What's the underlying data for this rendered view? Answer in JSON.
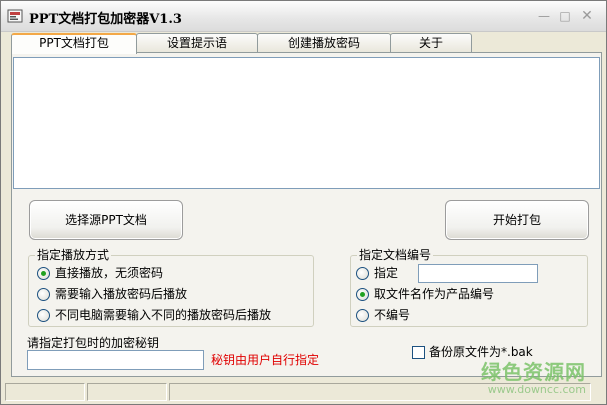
{
  "window": {
    "title": "PPT文档打包加密器V1.3",
    "controls": {
      "minimize": "—",
      "maximize": "□",
      "close": "✕"
    }
  },
  "tabs": [
    {
      "label": "PPT文档打包",
      "active": true
    },
    {
      "label": "设置提示语",
      "active": false
    },
    {
      "label": "创建播放密码",
      "active": false
    },
    {
      "label": "关于",
      "active": false
    }
  ],
  "buttons": {
    "select_source": "选择源PPT文档",
    "start_pack": "开始打包"
  },
  "play_mode": {
    "legend": "指定播放方式",
    "options": [
      {
        "label": "直接播放，无须密码",
        "checked": true
      },
      {
        "label": "需要输入播放密码后播放",
        "checked": false
      },
      {
        "label": "不同电脑需要输入不同的播放密码后播放",
        "checked": false
      }
    ]
  },
  "doc_number": {
    "legend": "指定文档编号",
    "options": [
      {
        "label": "指定",
        "checked": false
      },
      {
        "label": "取文件名作为产品编号",
        "checked": true
      },
      {
        "label": "不编号",
        "checked": false
      }
    ],
    "number_value": ""
  },
  "encryption_key": {
    "label": "请指定打包时的加密秘钥",
    "value": "",
    "hint": "秘钥由用户自行指定"
  },
  "backup": {
    "label": "备份原文件为*.bak",
    "checked": false
  },
  "watermark": {
    "main": "绿色资源网",
    "sub": "www.downcc.com"
  },
  "colors": {
    "window_bg": "#ece9d8",
    "panel_bg": "#f4f3ee",
    "active_tab_accent": "#f3a847",
    "radio_dot": "#21a121",
    "hint_red": "#e00000",
    "watermark_green": "#7cc36a"
  }
}
